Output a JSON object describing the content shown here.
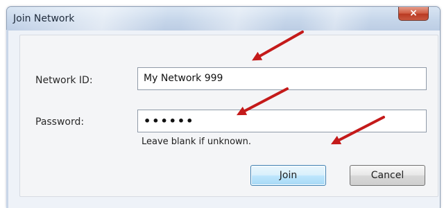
{
  "window": {
    "title": "Join Network",
    "close_glyph": "×"
  },
  "form": {
    "network_id_label": "Network ID:",
    "network_id_value": "My Network 999",
    "password_label": "Password:",
    "password_value": "••••••",
    "hint": "Leave blank if unknown."
  },
  "buttons": {
    "join": "Join",
    "cancel": "Cancel"
  },
  "colors": {
    "arrow": "#c41a1a",
    "close_button": "#c8573f",
    "default_button": "#bee6fd"
  },
  "icons": {
    "close": "close-icon"
  }
}
